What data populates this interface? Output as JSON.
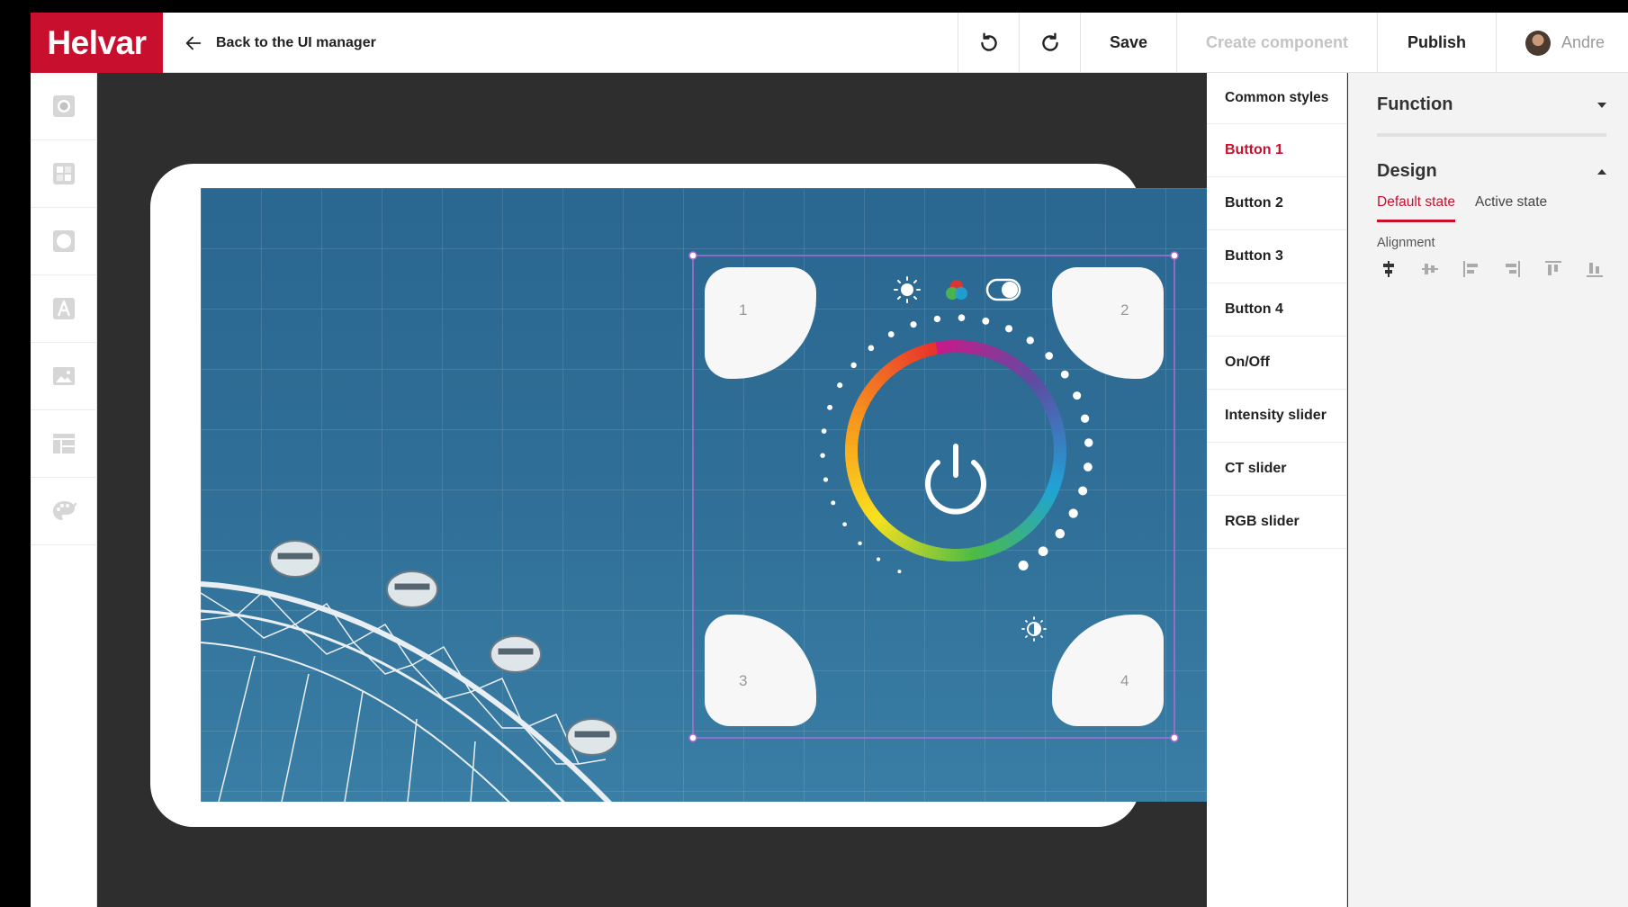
{
  "app": {
    "logo": "Helvar",
    "accent": "#c8102e"
  },
  "topbar": {
    "back_label": "Back to the UI manager",
    "save_label": "Save",
    "create_component_label": "Create component",
    "publish_label": "Publish",
    "user_name": "Andre"
  },
  "rail": {
    "icons": [
      "scene-icon",
      "components-icon",
      "shape-icon",
      "text-icon",
      "image-icon",
      "layout-icon",
      "palette-icon"
    ]
  },
  "canvas": {
    "buttons": [
      {
        "label": "1"
      },
      {
        "label": "2"
      },
      {
        "label": "3"
      },
      {
        "label": "4"
      }
    ],
    "ring_colors": [
      "#e8322b",
      "#f7941d",
      "#f9e11e",
      "#4cbb47",
      "#1fa3d6",
      "#5b4ea3",
      "#c51b8a"
    ]
  },
  "component_list": {
    "header": "Common styles",
    "items": [
      "Button 1",
      "Button 2",
      "Button 3",
      "Button 4",
      "On/Off",
      "Intensity slider",
      "CT slider",
      "RGB slider"
    ],
    "active_index": 0
  },
  "properties": {
    "function_title": "Function",
    "design_title": "Design",
    "tabs": [
      "Default state",
      "Active state"
    ],
    "active_tab": 0,
    "alignment_label": "Alignment",
    "alignment_icons": [
      "align-center-horizontal-icon",
      "align-center-vertical-icon",
      "align-left-icon",
      "align-right-icon",
      "align-top-icon",
      "align-bottom-icon"
    ]
  }
}
